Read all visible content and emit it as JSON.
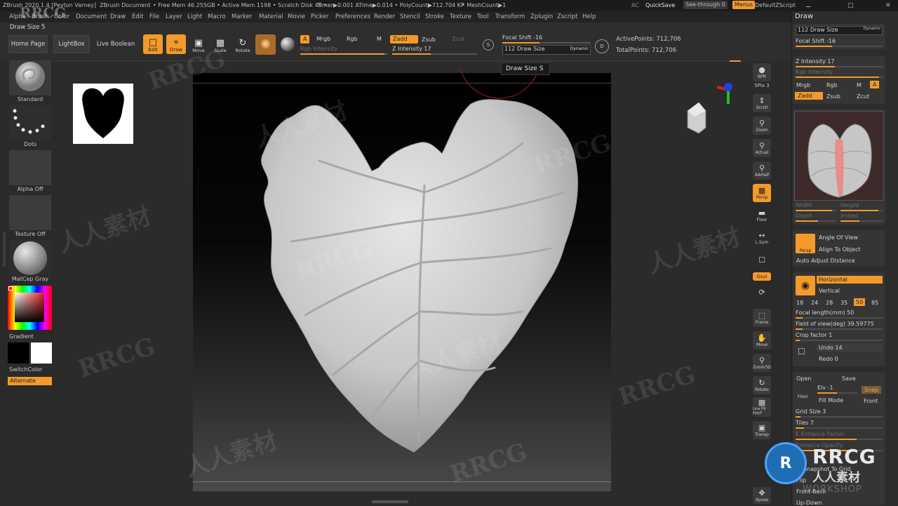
{
  "app": {
    "title_segments": [
      "ZBrush 2020.1.4 [Peyton Varney]",
      "ZBrush Document",
      "• Free Mem 46.255GB • Active Mem 1198 • Scratch Disk 48 •",
      "Timer▶0.001 ATime▶0.014 • PolyCount▶712.704 KP",
      "• MeshCount▶1"
    ],
    "quicksave": "QuickSave",
    "see_through": "See-through  0",
    "menus": "Menus",
    "default_zscript": "DefaultZScript"
  },
  "menu": [
    "Alpha",
    "Brush",
    "Color",
    "Document",
    "Draw",
    "Edit",
    "File",
    "Layer",
    "Light",
    "Macro",
    "Marker",
    "Material",
    "Movie",
    "Picker",
    "Preferences",
    "Render",
    "Stencil",
    "Stroke",
    "Texture",
    "Tool",
    "Transform",
    "Zplugin",
    "Zscript",
    "Help"
  ],
  "toolbar": {
    "draw_size_label": "Draw Size 5",
    "home_page": "Home Page",
    "lightbox": "LightBox",
    "live_boolean": "Live Boolean",
    "edit": "Edit",
    "draw": "Draw",
    "move": "Move",
    "scale": "Scale",
    "rotate": "Rotate",
    "a_tag": "A",
    "mrgb": "Mrgb",
    "rgb": "Rgb",
    "m": "M",
    "zadd": "Zadd",
    "zsub": "Zsub",
    "zcut": "Zcut",
    "rgb_intensity": "Rgb Intensity",
    "z_intensity": "Z Intensity 17",
    "z_intensity_value": 17,
    "focal_shift": "Focal Shift -16",
    "focal_shift_value": -16,
    "draw_size": "112 Draw Size",
    "draw_size_value": 112,
    "dynamic": "Dynamic",
    "active_points": "ActivePoints: 712,706",
    "total_points": "TotalPoints: 712,706",
    "tooltip": "Draw Size  S"
  },
  "left_shelf": {
    "brush": "Standard",
    "stroke": "Dots",
    "alpha": "Alpha Off",
    "texture": "Texture Off",
    "material": "MatCap Gray",
    "gradient": "Gradient",
    "switch_color": "SwitchColor",
    "alternate": "Alternate"
  },
  "right_strip": [
    {
      "icon": "bpr-icon",
      "label": "BPR"
    },
    {
      "icon": "spix-icon",
      "label": "SPix 3"
    },
    {
      "icon": "scroll-icon",
      "label": "Scroll"
    },
    {
      "icon": "zoom-icon",
      "label": "Zoom"
    },
    {
      "icon": "actual-icon",
      "label": "Actual"
    },
    {
      "icon": "aahalf-icon",
      "label": "AAHalf"
    },
    {
      "icon": "persp-icon",
      "label": "Persp"
    },
    {
      "icon": "floor-icon",
      "label": "Floor"
    },
    {
      "icon": "lsym-icon",
      "label": "L.Sym"
    },
    {
      "icon": "lock-icon",
      "label": ""
    },
    {
      "icon": "xyz-icon",
      "label": "Qxyz"
    },
    {
      "icon": "frame-icon",
      "label": "Frame"
    },
    {
      "icon": "move-icon",
      "label": "Move"
    },
    {
      "icon": "zoom3d-icon",
      "label": "Zoom3D"
    },
    {
      "icon": "rotate-icon",
      "label": "Rotate"
    },
    {
      "icon": "polyf-icon",
      "label": "Line Fill PolyF"
    },
    {
      "icon": "transp-icon",
      "label": "Transp"
    },
    {
      "icon": "xpose-icon",
      "label": "Xpose"
    }
  ],
  "right_panel": {
    "header": "Draw",
    "draw_size": "112 Draw Size",
    "dynamic": "Dynamic",
    "focal_shift": "Focal Shift -16",
    "z_intensity": "Z Intensity 17",
    "rgb_intensity": "Rgb Intensity",
    "mrgb": "Mrgb",
    "rgb": "Rgb",
    "m": "M",
    "a": "A",
    "zadd": "Zadd",
    "zsub": "Zsub",
    "zcut": "Zcut",
    "width": "Width",
    "height": "Height",
    "depth": "Depth",
    "imbed": "Imbed",
    "persp": "Persp",
    "angle_of_view": "Angle Of View",
    "align_to_object": "Align To Object",
    "auto_adjust_distance": "Auto Adjust Distance",
    "horizontal": "Horizontal",
    "vertical": "Vertical",
    "focal_options": [
      "18",
      "24",
      "28",
      "35",
      "50",
      "85"
    ],
    "focal_selected": "50",
    "focal_length": "Focal length(mm) 50",
    "field_of_view": "Field of view(deg) 39.59775",
    "crop_factor": "Crop factor 1",
    "undo": "Undo 14",
    "redo": "Redo 0",
    "open": "Open",
    "save": "Save",
    "elv": "Elv -1",
    "snap": "Snap",
    "floor": "Floor",
    "fill_mode": "Fill Mode",
    "front": "Front",
    "grid_size": "Grid Size 3",
    "tiles": "Tiles 7",
    "e_enhance_factor": "E Enhance Factor",
    "enhance_opacity": "Enhance Opacity",
    "snapshot_grid": "Snapshot To Grid",
    "flip": "Flip",
    "front_back": "Front-Back",
    "up_down": "Up-Down"
  },
  "watermarks": [
    "RRCG",
    "人人素材"
  ],
  "logo": {
    "big": "RRCG",
    "sub": "人人素材",
    "workshop": "WORKSHOP"
  },
  "colors": {
    "accent": "#f39a2b",
    "panel": "#2c2c2c",
    "title": "#1b1b1b"
  }
}
